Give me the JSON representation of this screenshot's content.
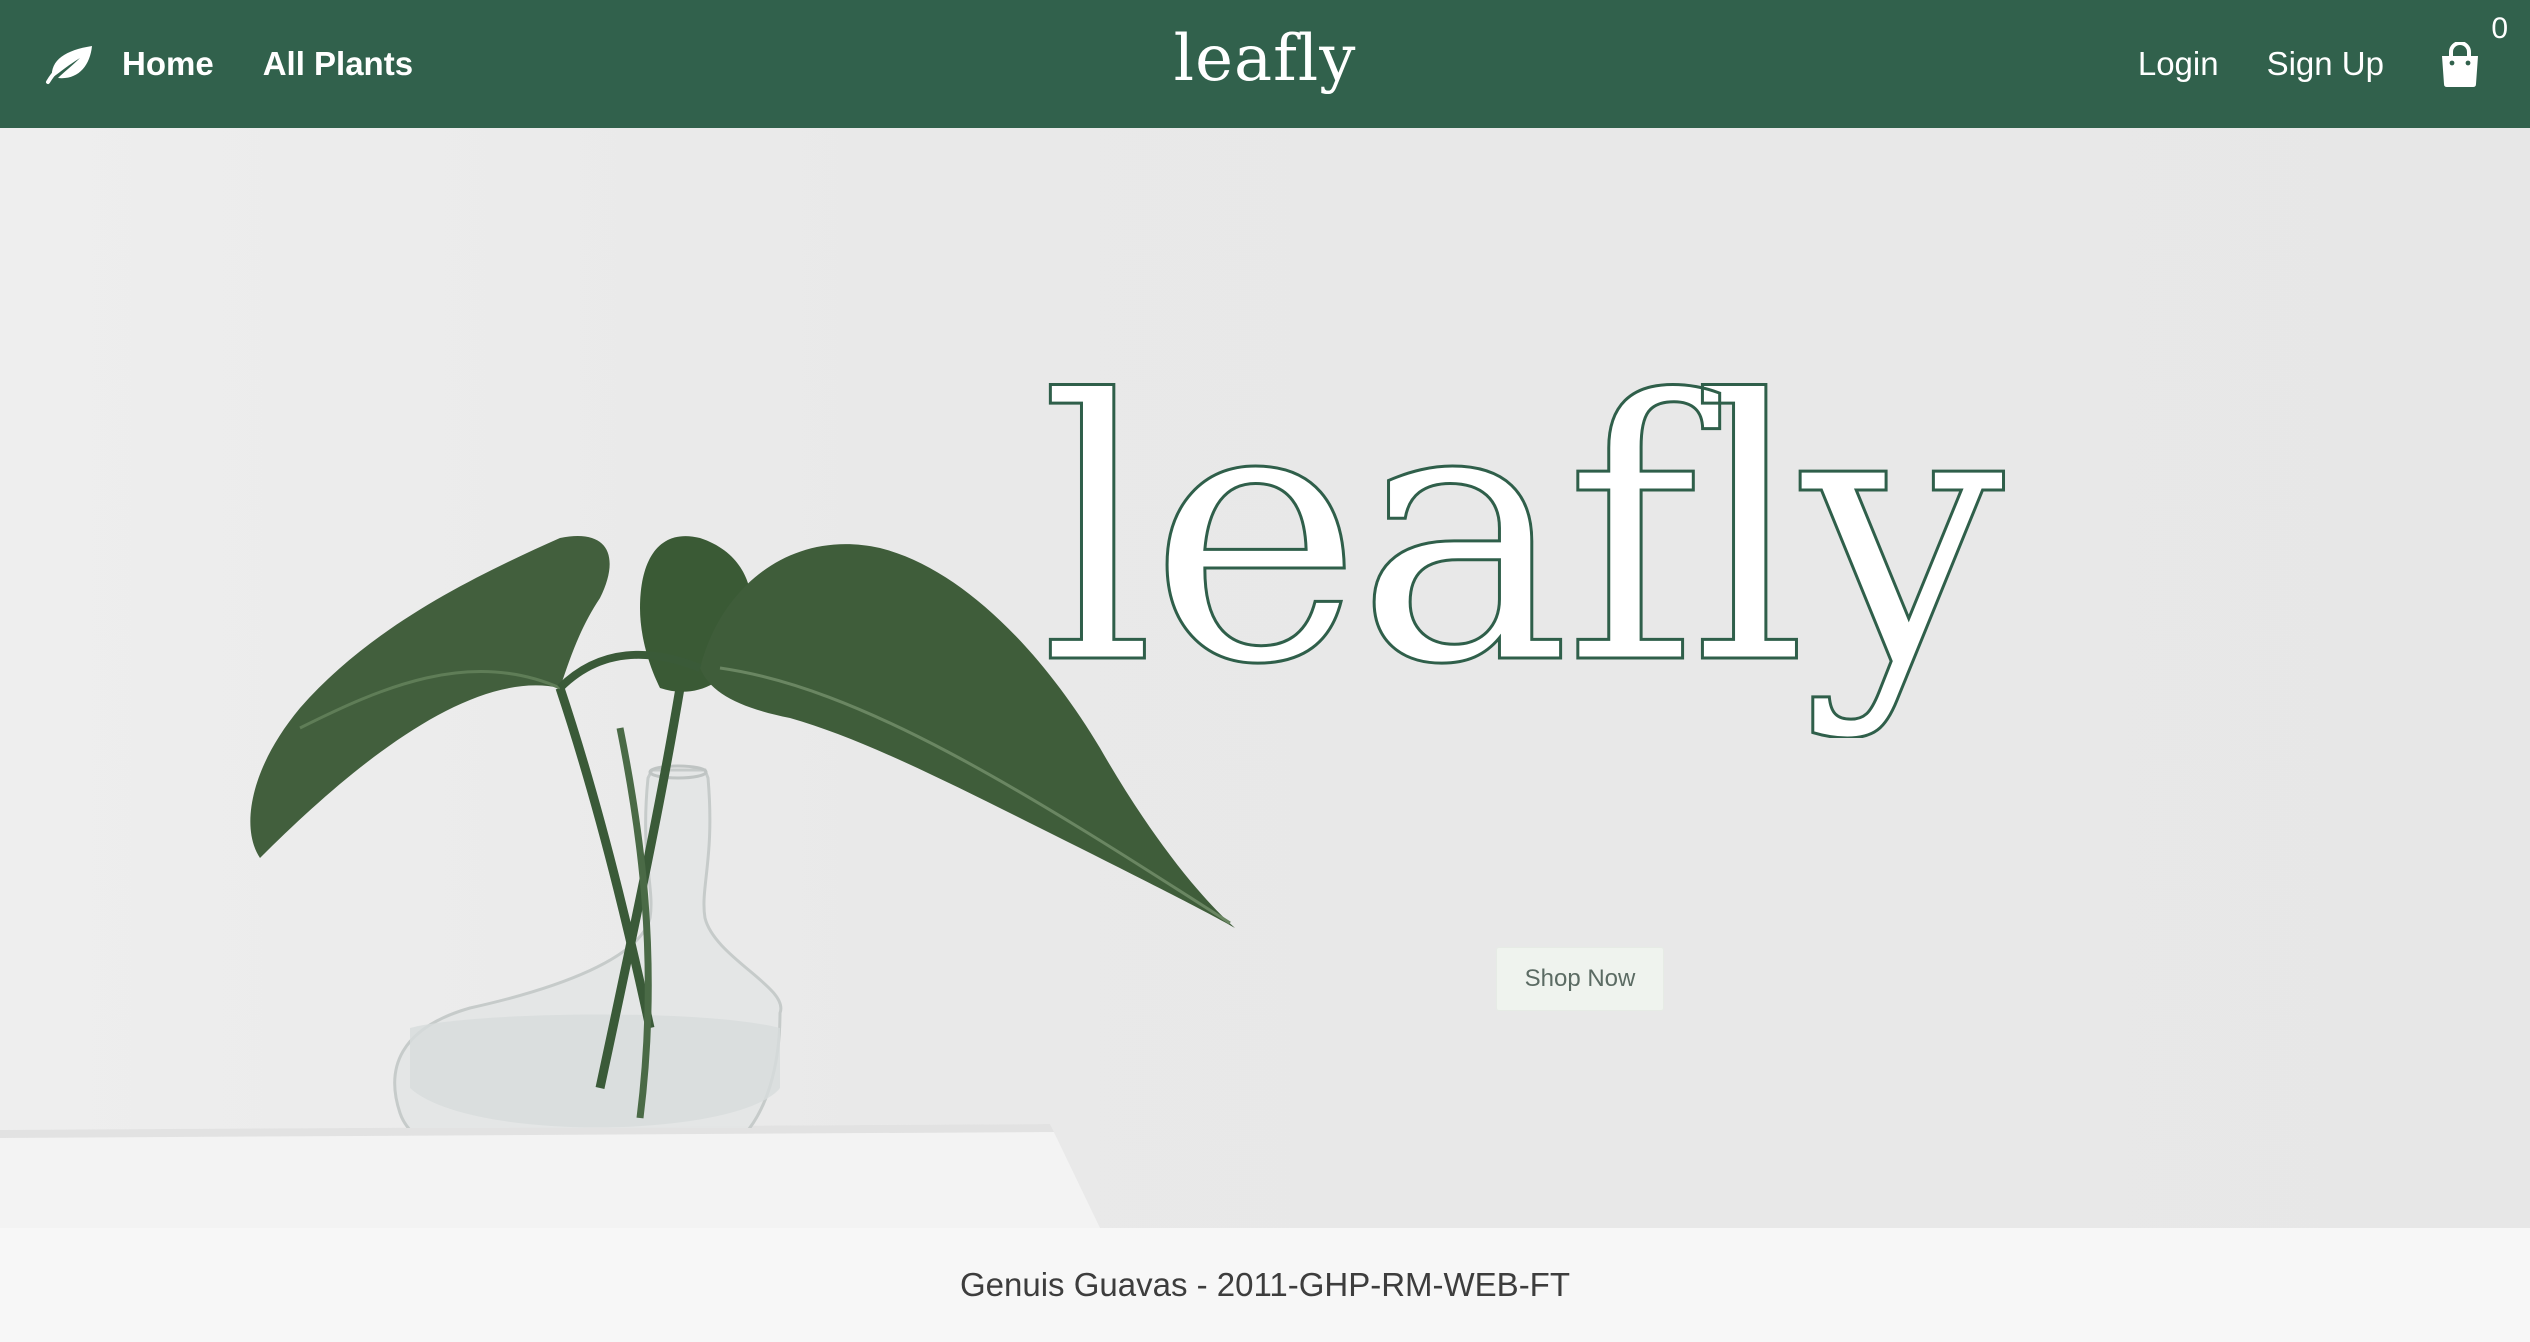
{
  "nav": {
    "logo_icon": "leaf-icon",
    "home_label": "Home",
    "all_plants_label": "All Plants",
    "brand": "leafly",
    "login_label": "Login",
    "signup_label": "Sign Up",
    "cart_icon": "shopping-bag-icon",
    "cart_count": "0"
  },
  "hero": {
    "title": "leafly",
    "button_label": "Shop Now"
  },
  "footer": {
    "text": "Genuis Guavas - 2011-GHP-RM-WEB-FT"
  },
  "colors": {
    "nav_bg": "#31614c",
    "hero_bg": "#e8e8e8",
    "outline_text": "#2f5f4a",
    "button_bg": "#eff3ee",
    "footer_bg": "#f7f7f7"
  }
}
